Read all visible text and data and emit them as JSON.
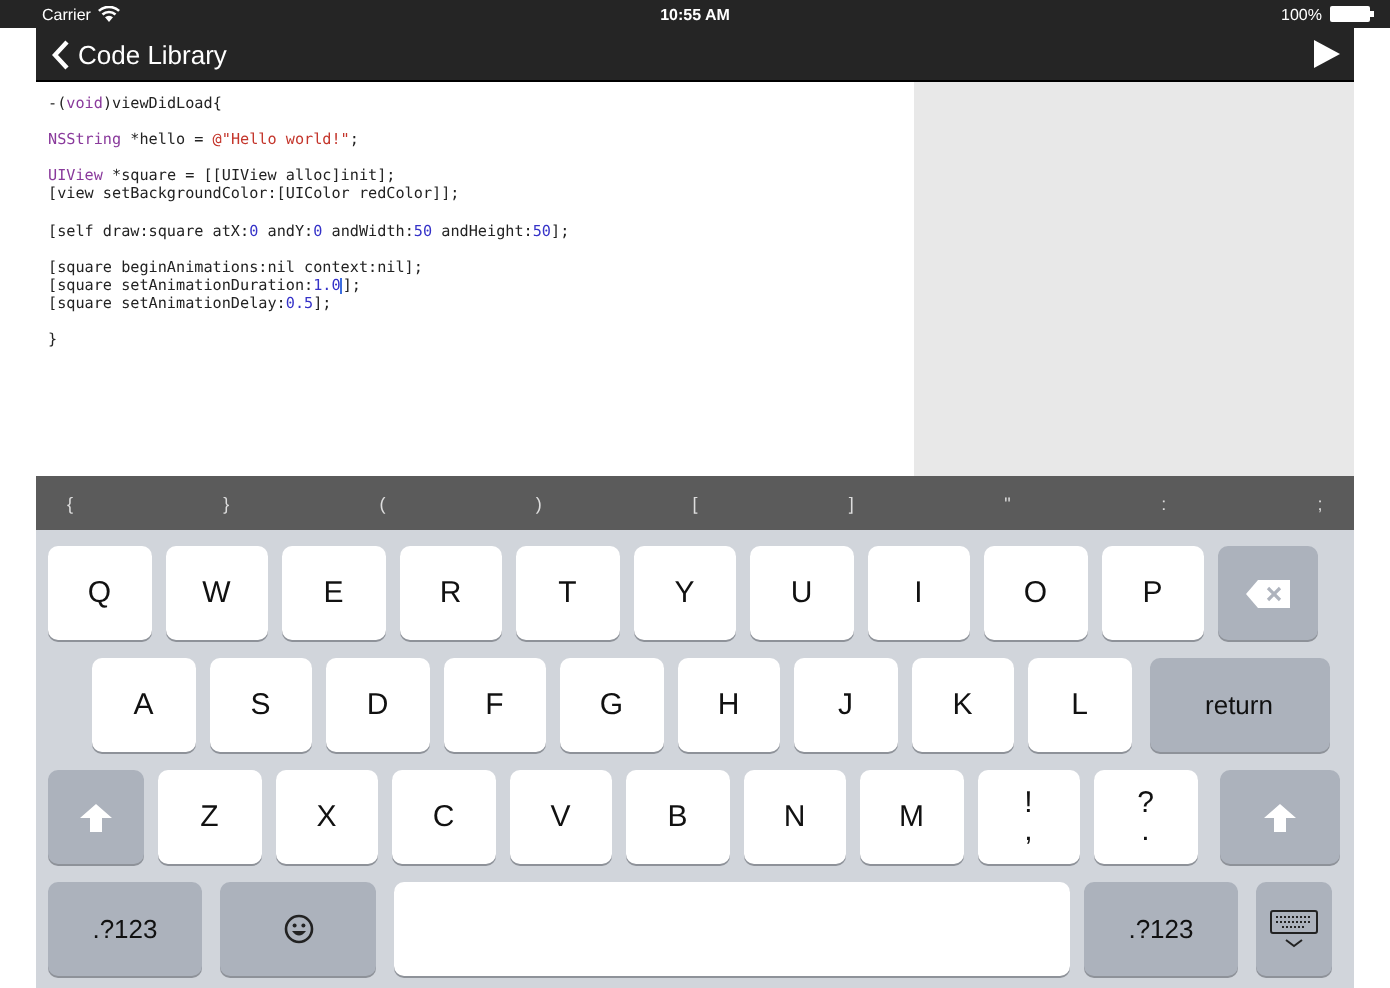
{
  "status_bar": {
    "carrier": "Carrier",
    "time": "10:55 AM",
    "battery": "100%"
  },
  "nav_bar": {
    "back": "Code Library"
  },
  "editor": {
    "blocks": [
      [
        [
          {
            "kind": "plain",
            "text": "-("
          },
          {
            "kind": "keyword",
            "text": "void"
          },
          {
            "kind": "plain",
            "text": ")viewDidLoad{"
          }
        ]
      ],
      [
        [
          {
            "kind": "keyword",
            "text": "NSString"
          },
          {
            "kind": "plain",
            "text": " *hello = "
          },
          {
            "kind": "string",
            "text": "@\"Hello world!\""
          },
          {
            "kind": "plain",
            "text": ";"
          }
        ]
      ],
      [
        [
          {
            "kind": "keyword",
            "text": "UIView"
          },
          {
            "kind": "plain",
            "text": " *square = [[UIView alloc]init];"
          }
        ],
        [
          {
            "kind": "plain",
            "text": "[view setBackgroundColor:[UIColor redColor]];"
          }
        ]
      ],
      [
        [
          {
            "kind": "plain",
            "text": "[self draw:square atX:"
          },
          {
            "kind": "number",
            "text": "0"
          },
          {
            "kind": "plain",
            "text": " andY:"
          },
          {
            "kind": "number",
            "text": "0"
          },
          {
            "kind": "plain",
            "text": " andWidth:"
          },
          {
            "kind": "number",
            "text": "50"
          },
          {
            "kind": "plain",
            "text": " andHeight:"
          },
          {
            "kind": "number",
            "text": "50"
          },
          {
            "kind": "plain",
            "text": "];"
          }
        ]
      ],
      [
        [
          {
            "kind": "plain",
            "text": "[square beginAnimations:nil context:nil];"
          }
        ],
        [
          {
            "kind": "plain",
            "text": "[square setAnimationDuration:"
          },
          {
            "kind": "number",
            "text": "1.0"
          },
          {
            "kind": "cursor"
          },
          {
            "kind": "plain",
            "text": "];"
          }
        ],
        [
          {
            "kind": "plain",
            "text": "[square setAnimationDelay:"
          },
          {
            "kind": "number",
            "text": "0.5"
          },
          {
            "kind": "plain",
            "text": "];"
          }
        ]
      ],
      [
        [
          {
            "kind": "plain",
            "text": "}"
          }
        ]
      ]
    ]
  },
  "accessory_keys": [
    "{",
    "}",
    "(",
    ")",
    "[",
    "]",
    "\"",
    ":",
    ";"
  ],
  "keyboard": {
    "letter_rows": [
      [
        {
          "kind": "char",
          "label": "Q"
        },
        {
          "kind": "char",
          "label": "W"
        },
        {
          "kind": "char",
          "label": "E"
        },
        {
          "kind": "char",
          "label": "R"
        },
        {
          "kind": "char",
          "label": "T"
        },
        {
          "kind": "char",
          "label": "Y"
        },
        {
          "kind": "char",
          "label": "U"
        },
        {
          "kind": "char",
          "label": "I"
        },
        {
          "kind": "char",
          "label": "O"
        },
        {
          "kind": "char",
          "label": "P"
        },
        {
          "kind": "delete"
        }
      ],
      [
        {
          "kind": "char",
          "label": "A"
        },
        {
          "kind": "char",
          "label": "S"
        },
        {
          "kind": "char",
          "label": "D"
        },
        {
          "kind": "char",
          "label": "F"
        },
        {
          "kind": "char",
          "label": "G"
        },
        {
          "kind": "char",
          "label": "H"
        },
        {
          "kind": "char",
          "label": "J"
        },
        {
          "kind": "char",
          "label": "K"
        },
        {
          "kind": "char",
          "label": "L"
        },
        {
          "kind": "return",
          "label": "return"
        }
      ],
      [
        {
          "kind": "shift"
        },
        {
          "kind": "char",
          "label": "Z"
        },
        {
          "kind": "char",
          "label": "X"
        },
        {
          "kind": "char",
          "label": "C"
        },
        {
          "kind": "char",
          "label": "V"
        },
        {
          "kind": "char",
          "label": "B"
        },
        {
          "kind": "char",
          "label": "N"
        },
        {
          "kind": "char",
          "label": "M"
        },
        {
          "kind": "dual",
          "top": "!",
          "bottom": ","
        },
        {
          "kind": "dual",
          "top": "?",
          "bottom": "."
        },
        {
          "kind": "shift"
        }
      ]
    ],
    "bottom_row": {
      "left_mode": ".?123",
      "right_mode": ".?123"
    }
  }
}
